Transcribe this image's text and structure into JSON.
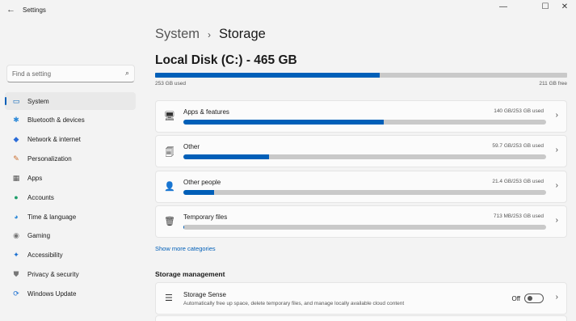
{
  "window": {
    "title": "Settings",
    "back_icon": "←",
    "minimize_icon": "—",
    "maximize_icon": "☐",
    "close_icon": "✕"
  },
  "sidebar": {
    "search": {
      "placeholder": "Find a setting",
      "icon": "⌕"
    },
    "items": [
      {
        "label": "System",
        "icon": "▭",
        "color": "#005fb8",
        "active": true
      },
      {
        "label": "Bluetooth & devices",
        "icon": "✱",
        "color": "#2b88d8"
      },
      {
        "label": "Network & internet",
        "icon": "◆",
        "color": "#2b6cd8"
      },
      {
        "label": "Personalization",
        "icon": "✎",
        "color": "#c96b2b"
      },
      {
        "label": "Apps",
        "icon": "▦",
        "color": "#555555"
      },
      {
        "label": "Accounts",
        "icon": "●",
        "color": "#1e9e6a"
      },
      {
        "label": "Time & language",
        "icon": "◕",
        "color": "#2b88d8"
      },
      {
        "label": "Gaming",
        "icon": "◉",
        "color": "#777777"
      },
      {
        "label": "Accessibility",
        "icon": "✦",
        "color": "#1a6fd1"
      },
      {
        "label": "Privacy & security",
        "icon": "⛊",
        "color": "#777777"
      },
      {
        "label": "Windows Update",
        "icon": "⟳",
        "color": "#1a6fd1"
      }
    ]
  },
  "breadcrumb": {
    "parent": "System",
    "separator": "›",
    "current": "Storage"
  },
  "disk": {
    "title": "Local Disk (C:) - 465 GB",
    "used_label": "253 GB used",
    "free_label": "211 GB free",
    "used_fraction": 0.545
  },
  "categories": [
    {
      "label": "Apps & features",
      "size": "140 GB/253 GB used",
      "fraction": 0.553,
      "icon": "🖥"
    },
    {
      "label": "Other",
      "size": "59.7 GB/253 GB used",
      "fraction": 0.236,
      "icon": "🗐"
    },
    {
      "label": "Other people",
      "size": "21.4 GB/253 GB used",
      "fraction": 0.085,
      "icon": "👤"
    },
    {
      "label": "Temporary files",
      "size": "713 MB/253 GB used",
      "fraction": 0.003,
      "icon": "🗑"
    }
  ],
  "show_more": "Show more categories",
  "storage_management": {
    "heading": "Storage management",
    "storage_sense": {
      "title": "Storage Sense",
      "description": "Automatically free up space, delete temporary files, and manage locally available cloud content",
      "toggle_label": "Off",
      "icon": "☰"
    }
  },
  "chevron_icon": "›",
  "colors": {
    "accent": "#005fb8",
    "track": "#c9c9c9"
  }
}
